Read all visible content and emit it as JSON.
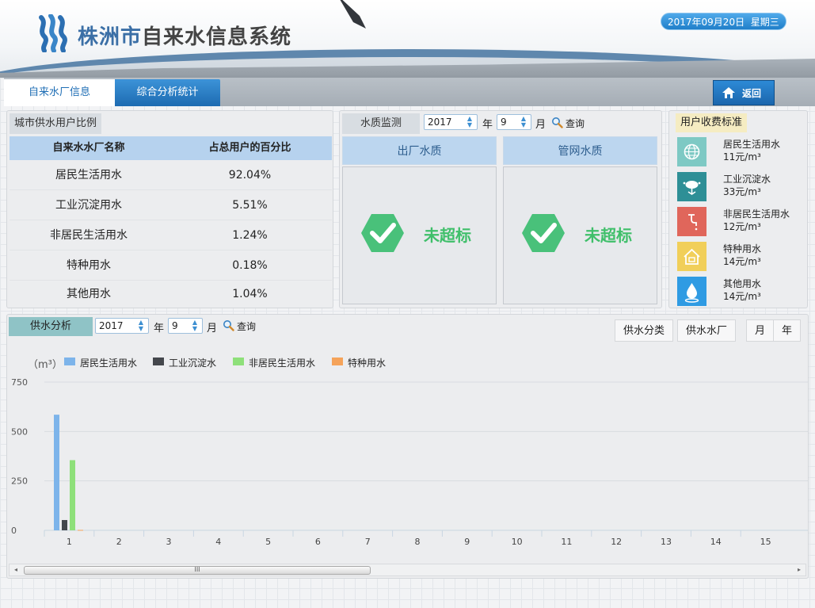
{
  "header": {
    "title_part1": "株洲市",
    "title_part2": "自来水信息系统",
    "date": "2017年09月20日",
    "weekday": "星期三"
  },
  "nav": {
    "tabs": [
      "自来水厂信息",
      "综合分析统计"
    ],
    "active_tab": 1,
    "back_label": "返回"
  },
  "users": {
    "tag": "城市供水用户比例",
    "headers": [
      "自来水水厂名称",
      "占总用户的百分比"
    ],
    "rows": [
      [
        "居民生活用水",
        "92.04%"
      ],
      [
        "工业沉淀用水",
        "5.51%"
      ],
      [
        "非居民生活用水",
        "1.24%"
      ],
      [
        "特种用水",
        "0.18%"
      ],
      [
        "其他用水",
        "1.04%"
      ]
    ]
  },
  "quality": {
    "tag": "水质监测",
    "year": "2017",
    "year_unit": "年",
    "month": "9",
    "month_unit": "月",
    "query": "查询",
    "columns": [
      {
        "title": "出厂水质",
        "status": "未超标"
      },
      {
        "title": "管网水质",
        "status": "未超标"
      }
    ],
    "status_color": "#3fbf6a"
  },
  "tariff": {
    "tag": "用户收费标准",
    "items": [
      {
        "name": "居民生活用水",
        "price": "11元/m³",
        "icon": "globe-icon",
        "color": "#7ec9c4"
      },
      {
        "name": "工业沉淀水",
        "price": "33元/m³",
        "icon": "factory-icon",
        "color": "#2e8f96"
      },
      {
        "name": "非居民生活用水",
        "price": "12元/m³",
        "icon": "faucet-icon",
        "color": "#e0665b"
      },
      {
        "name": "特种用水",
        "price": "14元/m³",
        "icon": "house-icon",
        "color": "#f1cf5a"
      },
      {
        "name": "其他用水",
        "price": "14元/m³",
        "icon": "drop-icon",
        "color": "#2f9be3"
      }
    ]
  },
  "supply": {
    "tag": "供水分析",
    "year": "2017",
    "year_unit": "年",
    "month": "9",
    "month_unit": "月",
    "query": "查询",
    "view_buttons": [
      "供水分类",
      "供水水厂"
    ],
    "period_buttons": [
      "月",
      "年"
    ],
    "unit_label": "（m³）",
    "scroll_grip": "III"
  },
  "chart_data": {
    "type": "bar",
    "categories": [
      "1",
      "2",
      "3",
      "4",
      "5",
      "6",
      "7",
      "8",
      "9",
      "10",
      "11",
      "12",
      "13",
      "14",
      "15"
    ],
    "series": [
      {
        "name": "居民生活用水",
        "color": "#7db4ea",
        "values": [
          585,
          0,
          0,
          0,
          0,
          0,
          0,
          0,
          0,
          0,
          0,
          0,
          0,
          0,
          0
        ]
      },
      {
        "name": "工业沉淀水",
        "color": "#44474c",
        "values": [
          52,
          0,
          0,
          0,
          0,
          0,
          0,
          0,
          0,
          0,
          0,
          0,
          0,
          0,
          0
        ]
      },
      {
        "name": "非居民生活用水",
        "color": "#8ee07a",
        "values": [
          355,
          0,
          0,
          0,
          0,
          0,
          0,
          0,
          0,
          0,
          0,
          0,
          0,
          0,
          0
        ]
      },
      {
        "name": "特种用水",
        "color": "#f5a35a",
        "values": [
          2,
          0,
          0,
          0,
          0,
          0,
          0,
          0,
          0,
          0,
          0,
          0,
          0,
          0,
          0
        ]
      }
    ],
    "yticks": [
      "0",
      "250",
      "500",
      "750"
    ],
    "ylim": [
      0,
      750
    ],
    "grid": true,
    "legend": "top-left"
  }
}
